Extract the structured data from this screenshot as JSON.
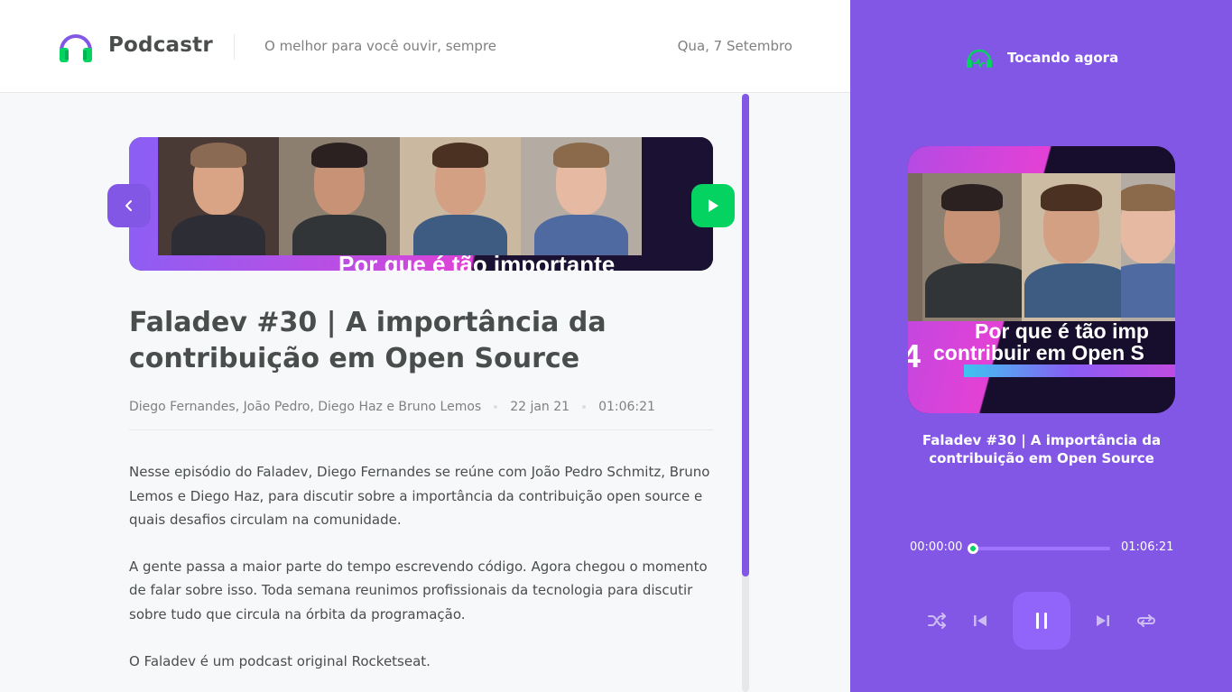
{
  "app": {
    "name": "Podcastr",
    "tagline": "O melhor para você ouvir, sempre",
    "date": "Qua, 7 Setembro"
  },
  "episode": {
    "title": "Faladev #30 | A importância da contribuição em Open Source",
    "members": "Diego Fernandes, João Pedro, Diego Haz e Bruno Lemos",
    "published_at": "22 jan 21",
    "duration": "01:06:21",
    "thumbnail_caption": "Por que é tão importante",
    "description": [
      "Nesse episódio do Faladev, Diego Fernandes se reúne com João Pedro Schmitz, Bruno Lemos e Diego Haz, para discutir sobre a importância da contribuição open source e quais desafios circulam na comunidade.",
      "A gente passa a maior parte do tempo escrevendo código. Agora chegou o momento de falar sobre isso. Toda semana reunimos profissionais da tecnologia para discutir sobre tudo que circula na órbita da programação.",
      "O Faladev é um podcast original Rocketseat."
    ]
  },
  "player": {
    "heading": "Tocando agora",
    "title": "Faladev #30 | A importância da contribuição em Open Source",
    "cover_caption_1": "Por que é tão imp",
    "cover_caption_2": "contribuir em Open S",
    "cover_number": "4",
    "current_time": "00:00:00",
    "total_time": "01:06:21",
    "progress": 0,
    "state": "playing"
  },
  "icons": {
    "logo": "headphones-icon",
    "back": "arrow-left-icon",
    "play": "play-icon",
    "now_playing": "headphones-wave-icon",
    "shuffle": "shuffle-icon",
    "previous": "skip-previous-icon",
    "pause": "pause-icon",
    "next": "skip-next-icon",
    "repeat": "repeat-icon"
  },
  "colors": {
    "brand": "#8257e5",
    "accent": "#04d361",
    "text": "#494d4b",
    "muted": "#808080"
  }
}
